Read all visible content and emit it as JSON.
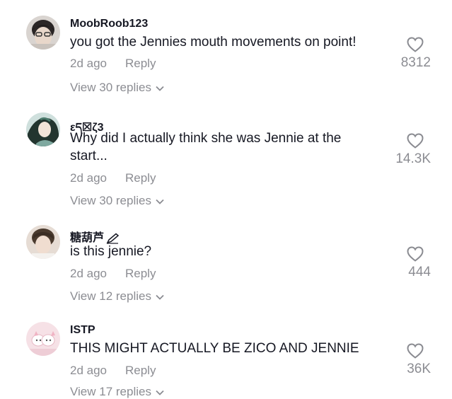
{
  "comments": [
    {
      "username": "MoobRoob123",
      "text": "you got the Jennies mouth movements on point!",
      "time": "2d ago",
      "reply_label": "Reply",
      "view_replies": "View 30 replies",
      "likes": "8312"
    },
    {
      "username": "εད☒ζ3",
      "text": "Why did I actually think she was Jennie at the start...",
      "time": "2d ago",
      "reply_label": "Reply",
      "view_replies": "View 30 replies",
      "likes": "14.3K"
    },
    {
      "username": "糖葫芦",
      "text": "is this jennie?",
      "time": "2d ago",
      "reply_label": "Reply",
      "view_replies": "View 12 replies",
      "likes": "444"
    },
    {
      "username": "ISTP",
      "text": "THIS MIGHT ACTUALLY BE ZICO AND JENNIE",
      "time": "2d ago",
      "reply_label": "Reply",
      "view_replies": "View 17 replies",
      "likes": "36K"
    }
  ],
  "colors": {
    "primary_text": "#161823",
    "secondary_text": "rgba(22,24,35,0.5)"
  },
  "icons": {
    "like": "heart-outline-icon",
    "expand": "chevron-down-icon",
    "username_decoration": "pencil-icon"
  }
}
